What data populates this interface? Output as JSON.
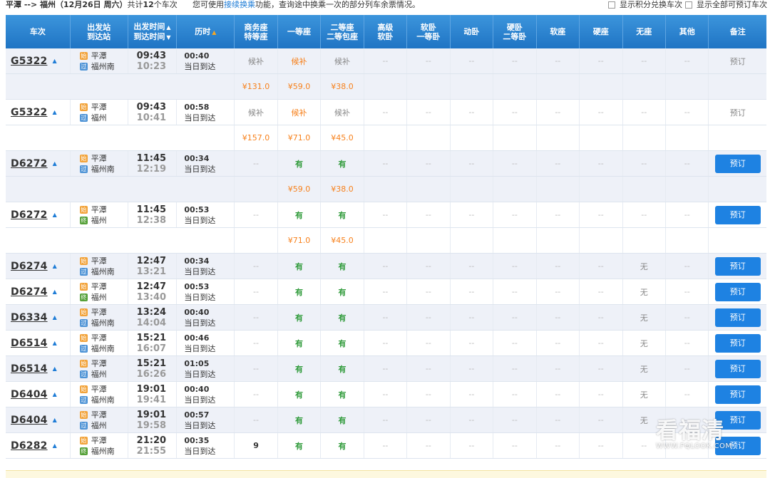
{
  "topbar": {
    "route": "平潭 --> 福州",
    "date": "（12月26日 周六）",
    "count_prefix": "共计",
    "count": "12",
    "count_suffix": "个车次",
    "tip_before": "您可使用",
    "tip_link": "接续换乘",
    "tip_after": "功能，查询途中换乘一次的部分列车余票情况。",
    "checkbox_points": "显示积分兑换车次",
    "checkbox_all": "显示全部可预订车次"
  },
  "headers": {
    "train": "车次",
    "station_1": "出发站",
    "station_2": "到达站",
    "time_1": "出发时间",
    "time_2": "到达时间",
    "duration": "历时",
    "business_1": "商务座",
    "business_2": "特等座",
    "first": "一等座",
    "second_1": "二等座",
    "second_2": "二等包座",
    "soft_sleeper_adv_1": "高级",
    "soft_sleeper_adv_2": "软卧",
    "soft_sleeper_1": "软卧",
    "soft_sleeper_2": "一等卧",
    "moving_sleeper": "动卧",
    "hard_sleeper_1": "硬卧",
    "hard_sleeper_2": "二等卧",
    "soft_seat": "软座",
    "hard_seat": "硬座",
    "no_seat": "无座",
    "other": "其他",
    "note": "备注"
  },
  "labels": {
    "same_day": "当日到达",
    "book": "预订",
    "dash": "--",
    "badge_start": "始",
    "badge_pass": "过",
    "badge_end": "终"
  },
  "trains": [
    {
      "code": "G5322",
      "from": "平潭",
      "to": "福州南",
      "from_type": "start",
      "to_type": "pass",
      "dep": "09:43",
      "arr": "10:23",
      "dur": "00:40",
      "seats": [
        "候补",
        "候补",
        "候补",
        "--",
        "--",
        "--",
        "--",
        "--",
        "--",
        "--",
        "--"
      ],
      "seat_styles": [
        "gray",
        "orange",
        "gray",
        "dash",
        "dash",
        "dash",
        "dash",
        "dash",
        "dash",
        "dash",
        "dash"
      ],
      "note": "预订",
      "note_type": "text",
      "prices": [
        "¥131.0",
        "¥59.0",
        "¥38.0"
      ]
    },
    {
      "code": "G5322",
      "from": "平潭",
      "to": "福州",
      "from_type": "start",
      "to_type": "pass",
      "dep": "09:43",
      "arr": "10:41",
      "dur": "00:58",
      "seats": [
        "候补",
        "候补",
        "候补",
        "--",
        "--",
        "--",
        "--",
        "--",
        "--",
        "--",
        "--"
      ],
      "seat_styles": [
        "gray",
        "orange",
        "gray",
        "dash",
        "dash",
        "dash",
        "dash",
        "dash",
        "dash",
        "dash",
        "dash"
      ],
      "note": "预订",
      "note_type": "text",
      "prices": [
        "¥157.0",
        "¥71.0",
        "¥45.0"
      ]
    },
    {
      "code": "D6272",
      "from": "平潭",
      "to": "福州南",
      "from_type": "start",
      "to_type": "pass",
      "dep": "11:45",
      "arr": "12:19",
      "dur": "00:34",
      "seats": [
        "--",
        "有",
        "有",
        "--",
        "--",
        "--",
        "--",
        "--",
        "--",
        "--",
        "--"
      ],
      "seat_styles": [
        "dash",
        "green",
        "green",
        "dash",
        "dash",
        "dash",
        "dash",
        "dash",
        "dash",
        "dash",
        "dash"
      ],
      "note": "预订",
      "note_type": "button",
      "prices": [
        "",
        "¥59.0",
        "¥38.0"
      ]
    },
    {
      "code": "D6272",
      "from": "平潭",
      "to": "福州",
      "from_type": "start",
      "to_type": "end",
      "dep": "11:45",
      "arr": "12:38",
      "dur": "00:53",
      "seats": [
        "--",
        "有",
        "有",
        "--",
        "--",
        "--",
        "--",
        "--",
        "--",
        "--",
        "--"
      ],
      "seat_styles": [
        "dash",
        "green",
        "green",
        "dash",
        "dash",
        "dash",
        "dash",
        "dash",
        "dash",
        "dash",
        "dash"
      ],
      "note": "预订",
      "note_type": "button",
      "prices": [
        "",
        "¥71.0",
        "¥45.0"
      ]
    },
    {
      "code": "D6274",
      "from": "平潭",
      "to": "福州南",
      "from_type": "start",
      "to_type": "pass",
      "dep": "12:47",
      "arr": "13:21",
      "dur": "00:34",
      "seats": [
        "--",
        "有",
        "有",
        "--",
        "--",
        "--",
        "--",
        "--",
        "--",
        "无",
        "--"
      ],
      "seat_styles": [
        "dash",
        "green",
        "green",
        "dash",
        "dash",
        "dash",
        "dash",
        "dash",
        "dash",
        "none",
        "dash"
      ],
      "note": "预订",
      "note_type": "button"
    },
    {
      "code": "D6274",
      "from": "平潭",
      "to": "福州",
      "from_type": "start",
      "to_type": "end",
      "dep": "12:47",
      "arr": "13:40",
      "dur": "00:53",
      "seats": [
        "--",
        "有",
        "有",
        "--",
        "--",
        "--",
        "--",
        "--",
        "--",
        "无",
        "--"
      ],
      "seat_styles": [
        "dash",
        "green",
        "green",
        "dash",
        "dash",
        "dash",
        "dash",
        "dash",
        "dash",
        "none",
        "dash"
      ],
      "note": "预订",
      "note_type": "button"
    },
    {
      "code": "D6334",
      "from": "平潭",
      "to": "福州南",
      "from_type": "start",
      "to_type": "pass",
      "dep": "13:24",
      "arr": "14:04",
      "dur": "00:40",
      "seats": [
        "--",
        "有",
        "有",
        "--",
        "--",
        "--",
        "--",
        "--",
        "--",
        "无",
        "--"
      ],
      "seat_styles": [
        "dash",
        "green",
        "green",
        "dash",
        "dash",
        "dash",
        "dash",
        "dash",
        "dash",
        "none",
        "dash"
      ],
      "note": "预订",
      "note_type": "button"
    },
    {
      "code": "D6514",
      "from": "平潭",
      "to": "福州南",
      "from_type": "start",
      "to_type": "pass",
      "dep": "15:21",
      "arr": "16:07",
      "dur": "00:46",
      "seats": [
        "--",
        "有",
        "有",
        "--",
        "--",
        "--",
        "--",
        "--",
        "--",
        "无",
        "--"
      ],
      "seat_styles": [
        "dash",
        "green",
        "green",
        "dash",
        "dash",
        "dash",
        "dash",
        "dash",
        "dash",
        "none",
        "dash"
      ],
      "note": "预订",
      "note_type": "button"
    },
    {
      "code": "D6514",
      "from": "平潭",
      "to": "福州",
      "from_type": "start",
      "to_type": "pass",
      "dep": "15:21",
      "arr": "16:26",
      "dur": "01:05",
      "seats": [
        "--",
        "有",
        "有",
        "--",
        "--",
        "--",
        "--",
        "--",
        "--",
        "无",
        "--"
      ],
      "seat_styles": [
        "dash",
        "green",
        "green",
        "dash",
        "dash",
        "dash",
        "dash",
        "dash",
        "dash",
        "none",
        "dash"
      ],
      "note": "预订",
      "note_type": "button"
    },
    {
      "code": "D6404",
      "from": "平潭",
      "to": "福州南",
      "from_type": "start",
      "to_type": "pass",
      "dep": "19:01",
      "arr": "19:41",
      "dur": "00:40",
      "seats": [
        "--",
        "有",
        "有",
        "--",
        "--",
        "--",
        "--",
        "--",
        "--",
        "无",
        "--"
      ],
      "seat_styles": [
        "dash",
        "green",
        "green",
        "dash",
        "dash",
        "dash",
        "dash",
        "dash",
        "dash",
        "none",
        "dash"
      ],
      "note": "预订",
      "note_type": "button"
    },
    {
      "code": "D6404",
      "from": "平潭",
      "to": "福州",
      "from_type": "start",
      "to_type": "pass",
      "dep": "19:01",
      "arr": "19:58",
      "dur": "00:57",
      "seats": [
        "--",
        "有",
        "有",
        "--",
        "--",
        "--",
        "--",
        "--",
        "--",
        "无",
        "--"
      ],
      "seat_styles": [
        "dash",
        "green",
        "green",
        "dash",
        "dash",
        "dash",
        "dash",
        "dash",
        "dash",
        "none",
        "dash"
      ],
      "note": "预订",
      "note_type": "button"
    },
    {
      "code": "D6282",
      "from": "平潭",
      "to": "福州南",
      "from_type": "start",
      "to_type": "end",
      "dep": "21:20",
      "arr": "21:55",
      "dur": "00:35",
      "seats": [
        "9",
        "有",
        "有",
        "--",
        "--",
        "--",
        "--",
        "--",
        "--",
        "--",
        "--"
      ],
      "seat_styles": [
        "num",
        "green",
        "green",
        "dash",
        "dash",
        "dash",
        "dash",
        "dash",
        "dash",
        "dash",
        "dash"
      ],
      "note": "预订",
      "note_type": "button"
    }
  ],
  "watermark": {
    "brand": "看福清",
    "url": "WWW.FQLOOK.COM"
  }
}
